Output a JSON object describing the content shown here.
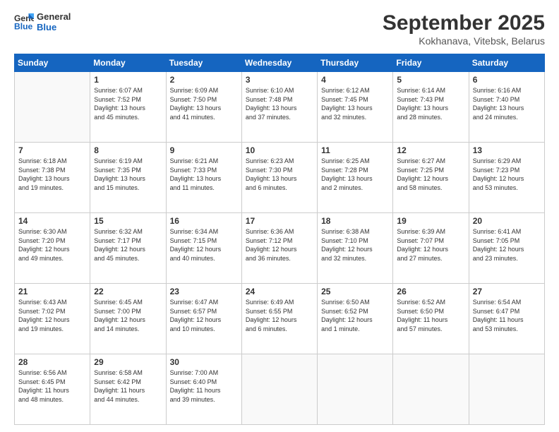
{
  "header": {
    "logo_general": "General",
    "logo_blue": "Blue",
    "month_title": "September 2025",
    "location": "Kokhanava, Vitebsk, Belarus"
  },
  "weekdays": [
    "Sunday",
    "Monday",
    "Tuesday",
    "Wednesday",
    "Thursday",
    "Friday",
    "Saturday"
  ],
  "weeks": [
    [
      {
        "day": "",
        "info": ""
      },
      {
        "day": "1",
        "info": "Sunrise: 6:07 AM\nSunset: 7:52 PM\nDaylight: 13 hours\nand 45 minutes."
      },
      {
        "day": "2",
        "info": "Sunrise: 6:09 AM\nSunset: 7:50 PM\nDaylight: 13 hours\nand 41 minutes."
      },
      {
        "day": "3",
        "info": "Sunrise: 6:10 AM\nSunset: 7:48 PM\nDaylight: 13 hours\nand 37 minutes."
      },
      {
        "day": "4",
        "info": "Sunrise: 6:12 AM\nSunset: 7:45 PM\nDaylight: 13 hours\nand 32 minutes."
      },
      {
        "day": "5",
        "info": "Sunrise: 6:14 AM\nSunset: 7:43 PM\nDaylight: 13 hours\nand 28 minutes."
      },
      {
        "day": "6",
        "info": "Sunrise: 6:16 AM\nSunset: 7:40 PM\nDaylight: 13 hours\nand 24 minutes."
      }
    ],
    [
      {
        "day": "7",
        "info": "Sunrise: 6:18 AM\nSunset: 7:38 PM\nDaylight: 13 hours\nand 19 minutes."
      },
      {
        "day": "8",
        "info": "Sunrise: 6:19 AM\nSunset: 7:35 PM\nDaylight: 13 hours\nand 15 minutes."
      },
      {
        "day": "9",
        "info": "Sunrise: 6:21 AM\nSunset: 7:33 PM\nDaylight: 13 hours\nand 11 minutes."
      },
      {
        "day": "10",
        "info": "Sunrise: 6:23 AM\nSunset: 7:30 PM\nDaylight: 13 hours\nand 6 minutes."
      },
      {
        "day": "11",
        "info": "Sunrise: 6:25 AM\nSunset: 7:28 PM\nDaylight: 13 hours\nand 2 minutes."
      },
      {
        "day": "12",
        "info": "Sunrise: 6:27 AM\nSunset: 7:25 PM\nDaylight: 12 hours\nand 58 minutes."
      },
      {
        "day": "13",
        "info": "Sunrise: 6:29 AM\nSunset: 7:23 PM\nDaylight: 12 hours\nand 53 minutes."
      }
    ],
    [
      {
        "day": "14",
        "info": "Sunrise: 6:30 AM\nSunset: 7:20 PM\nDaylight: 12 hours\nand 49 minutes."
      },
      {
        "day": "15",
        "info": "Sunrise: 6:32 AM\nSunset: 7:17 PM\nDaylight: 12 hours\nand 45 minutes."
      },
      {
        "day": "16",
        "info": "Sunrise: 6:34 AM\nSunset: 7:15 PM\nDaylight: 12 hours\nand 40 minutes."
      },
      {
        "day": "17",
        "info": "Sunrise: 6:36 AM\nSunset: 7:12 PM\nDaylight: 12 hours\nand 36 minutes."
      },
      {
        "day": "18",
        "info": "Sunrise: 6:38 AM\nSunset: 7:10 PM\nDaylight: 12 hours\nand 32 minutes."
      },
      {
        "day": "19",
        "info": "Sunrise: 6:39 AM\nSunset: 7:07 PM\nDaylight: 12 hours\nand 27 minutes."
      },
      {
        "day": "20",
        "info": "Sunrise: 6:41 AM\nSunset: 7:05 PM\nDaylight: 12 hours\nand 23 minutes."
      }
    ],
    [
      {
        "day": "21",
        "info": "Sunrise: 6:43 AM\nSunset: 7:02 PM\nDaylight: 12 hours\nand 19 minutes."
      },
      {
        "day": "22",
        "info": "Sunrise: 6:45 AM\nSunset: 7:00 PM\nDaylight: 12 hours\nand 14 minutes."
      },
      {
        "day": "23",
        "info": "Sunrise: 6:47 AM\nSunset: 6:57 PM\nDaylight: 12 hours\nand 10 minutes."
      },
      {
        "day": "24",
        "info": "Sunrise: 6:49 AM\nSunset: 6:55 PM\nDaylight: 12 hours\nand 6 minutes."
      },
      {
        "day": "25",
        "info": "Sunrise: 6:50 AM\nSunset: 6:52 PM\nDaylight: 12 hours\nand 1 minute."
      },
      {
        "day": "26",
        "info": "Sunrise: 6:52 AM\nSunset: 6:50 PM\nDaylight: 11 hours\nand 57 minutes."
      },
      {
        "day": "27",
        "info": "Sunrise: 6:54 AM\nSunset: 6:47 PM\nDaylight: 11 hours\nand 53 minutes."
      }
    ],
    [
      {
        "day": "28",
        "info": "Sunrise: 6:56 AM\nSunset: 6:45 PM\nDaylight: 11 hours\nand 48 minutes."
      },
      {
        "day": "29",
        "info": "Sunrise: 6:58 AM\nSunset: 6:42 PM\nDaylight: 11 hours\nand 44 minutes."
      },
      {
        "day": "30",
        "info": "Sunrise: 7:00 AM\nSunset: 6:40 PM\nDaylight: 11 hours\nand 39 minutes."
      },
      {
        "day": "",
        "info": ""
      },
      {
        "day": "",
        "info": ""
      },
      {
        "day": "",
        "info": ""
      },
      {
        "day": "",
        "info": ""
      }
    ]
  ]
}
